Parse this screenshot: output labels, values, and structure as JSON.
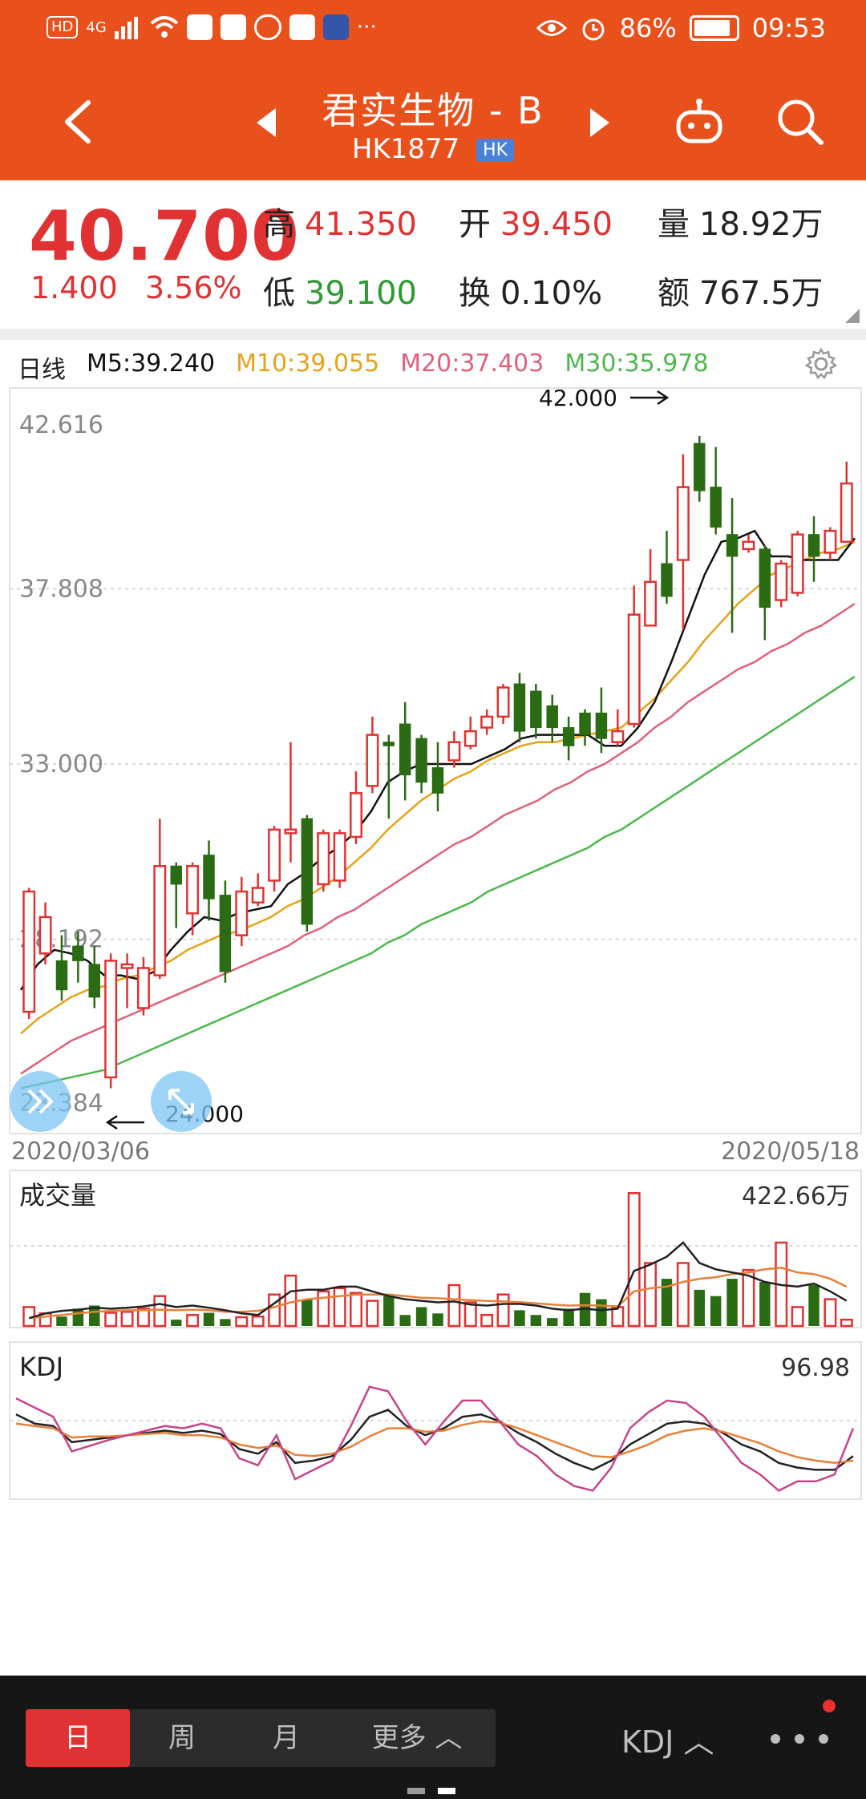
{
  "status_bar": {
    "hd": "HD",
    "network": "4G",
    "battery": "86%",
    "time": "09:53"
  },
  "header": {
    "title": "君实生物 - B",
    "code": "HK1877",
    "market_badge": "HK"
  },
  "quote": {
    "price": "40.700",
    "change": "1.400",
    "change_pct": "3.56%",
    "high_label": "高",
    "high": "41.350",
    "low_label": "低",
    "low": "39.100",
    "open_label": "开",
    "open": "39.450",
    "turnover_label": "换",
    "turnover": "0.10%",
    "volume_label": "量",
    "volume": "18.92万",
    "amount_label": "额",
    "amount": "767.5万"
  },
  "chart_header": {
    "period": "日线",
    "m5": "M5:39.240",
    "m10": "M10:39.055",
    "m20": "M20:37.403",
    "m30": "M30:35.978"
  },
  "colors": {
    "accent": "#e8501c",
    "up": "#e03232",
    "down": "#2a6b14",
    "ma5": "#111111",
    "ma10": "#e6a21a",
    "ma20": "#e0607a",
    "ma30": "#4cb84c",
    "kdj_j": "#c8438a",
    "vol_ma": "#e8803a"
  },
  "chart_data": [
    {
      "type": "candlestick",
      "title": "",
      "y_ticks": [
        "42.616",
        "37.808",
        "33.000",
        "28.192",
        "23.384"
      ],
      "ylim": [
        23.384,
        42.616
      ],
      "x_start": "2020/03/06",
      "x_end": "2020/05/18",
      "annotations": {
        "max": "42.000",
        "min": "24.000"
      },
      "candles": [
        [
          26.2,
          29.5,
          26.0,
          29.6
        ],
        [
          27.8,
          28.8,
          27.5,
          29.2
        ],
        [
          27.6,
          26.8,
          26.5,
          28.3
        ],
        [
          28.0,
          27.6,
          27.0,
          28.4
        ],
        [
          27.5,
          26.6,
          26.3,
          28.0
        ],
        [
          24.4,
          27.6,
          24.1,
          27.8
        ],
        [
          27.4,
          27.5,
          26.3,
          27.8
        ],
        [
          26.3,
          27.4,
          26.1,
          27.7
        ],
        [
          27.2,
          30.2,
          27.1,
          31.5
        ],
        [
          30.2,
          29.7,
          28.5,
          30.3
        ],
        [
          28.9,
          30.2,
          28.3,
          30.3
        ],
        [
          30.5,
          29.3,
          28.7,
          30.9
        ],
        [
          29.4,
          27.3,
          27.0,
          29.8
        ],
        [
          28.3,
          29.5,
          28.0,
          29.9
        ],
        [
          29.2,
          29.6,
          29.1,
          30.0
        ],
        [
          29.8,
          31.2,
          29.5,
          31.3
        ],
        [
          31.1,
          31.2,
          30.3,
          33.6
        ],
        [
          31.5,
          28.6,
          28.4,
          31.6
        ],
        [
          29.7,
          31.1,
          29.5,
          31.2
        ],
        [
          29.8,
          31.1,
          29.6,
          31.2
        ],
        [
          31.0,
          32.2,
          30.8,
          32.8
        ],
        [
          32.4,
          33.8,
          32.2,
          34.3
        ],
        [
          33.6,
          33.5,
          31.5,
          33.8
        ],
        [
          34.1,
          32.7,
          32.0,
          34.7
        ],
        [
          33.7,
          32.5,
          32.2,
          33.8
        ],
        [
          32.9,
          32.2,
          31.7,
          33.6
        ],
        [
          33.1,
          33.6,
          32.9,
          33.9
        ],
        [
          33.5,
          33.9,
          33.4,
          34.3
        ],
        [
          34.0,
          34.3,
          33.8,
          34.5
        ],
        [
          34.3,
          35.1,
          34.1,
          35.2
        ],
        [
          35.2,
          33.9,
          33.6,
          35.5
        ],
        [
          35.0,
          34.0,
          33.7,
          35.2
        ],
        [
          34.6,
          34.0,
          33.6,
          34.9
        ],
        [
          34.0,
          33.5,
          33.1,
          34.3
        ],
        [
          34.4,
          33.8,
          33.5,
          34.5
        ],
        [
          34.4,
          33.7,
          33.3,
          35.1
        ],
        [
          33.6,
          33.9,
          33.5,
          34.5
        ],
        [
          34.1,
          37.1,
          34.0,
          37.9
        ],
        [
          36.8,
          38.0,
          36.8,
          38.9
        ],
        [
          38.5,
          37.6,
          37.4,
          39.4
        ],
        [
          38.6,
          40.6,
          36.7,
          41.5
        ],
        [
          41.8,
          40.5,
          40.2,
          42.0
        ],
        [
          40.6,
          39.5,
          39.3,
          41.7
        ],
        [
          39.3,
          38.7,
          36.6,
          40.3
        ],
        [
          38.9,
          39.1,
          38.8,
          39.3
        ],
        [
          38.9,
          37.3,
          36.4,
          39.0
        ],
        [
          37.5,
          38.5,
          37.3,
          38.6
        ],
        [
          37.7,
          39.3,
          37.6,
          39.4
        ],
        [
          39.3,
          38.7,
          38.0,
          39.8
        ],
        [
          38.8,
          39.4,
          38.6,
          39.5
        ],
        [
          39.1,
          40.7,
          39.1,
          41.3
        ]
      ],
      "ma5": [
        26.8,
        27.5,
        27.9,
        27.8,
        27.6,
        27.2,
        27.2,
        27.1,
        27.3,
        27.9,
        28.4,
        28.8,
        28.7,
        28.9,
        29.0,
        29.1,
        29.7,
        30.0,
        30.4,
        30.7,
        31.1,
        31.7,
        32.5,
        32.8,
        33.0,
        33.0,
        33.0,
        33.0,
        33.2,
        33.4,
        33.7,
        33.8,
        33.8,
        33.8,
        33.8,
        33.5,
        33.5,
        34.0,
        34.7,
        35.8,
        37.0,
        38.2,
        39.1,
        39.2,
        39.4,
        38.7,
        38.7,
        38.6,
        38.6,
        38.6,
        39.2
      ],
      "ma10": [
        25.6,
        26.0,
        26.3,
        26.6,
        26.8,
        26.9,
        27.1,
        27.2,
        27.4,
        27.6,
        27.9,
        28.1,
        28.3,
        28.4,
        28.6,
        28.8,
        29.1,
        29.3,
        29.6,
        29.9,
        30.3,
        30.7,
        31.2,
        31.6,
        32.0,
        32.3,
        32.6,
        32.8,
        33.1,
        33.3,
        33.5,
        33.6,
        33.6,
        33.7,
        33.8,
        33.9,
        34.0,
        34.4,
        34.8,
        35.3,
        35.8,
        36.4,
        36.9,
        37.4,
        37.8,
        38.2,
        38.4,
        38.6,
        38.8,
        38.9,
        39.1
      ],
      "ma20": [
        24.5,
        24.8,
        25.1,
        25.4,
        25.6,
        25.8,
        26.0,
        26.2,
        26.4,
        26.6,
        26.8,
        27.0,
        27.2,
        27.4,
        27.6,
        27.8,
        28.0,
        28.3,
        28.5,
        28.8,
        29.0,
        29.3,
        29.6,
        29.9,
        30.2,
        30.5,
        30.8,
        31.0,
        31.3,
        31.6,
        31.8,
        32.0,
        32.3,
        32.5,
        32.8,
        33.0,
        33.3,
        33.6,
        34.0,
        34.3,
        34.7,
        35.0,
        35.3,
        35.6,
        35.8,
        36.1,
        36.3,
        36.6,
        36.8,
        37.1,
        37.4
      ],
      "ma30": [
        24.1,
        24.2,
        24.3,
        24.4,
        24.5,
        24.6,
        24.8,
        25.0,
        25.2,
        25.4,
        25.6,
        25.8,
        26.0,
        26.2,
        26.4,
        26.6,
        26.8,
        27.0,
        27.2,
        27.4,
        27.6,
        27.8,
        28.1,
        28.3,
        28.6,
        28.8,
        29.0,
        29.2,
        29.5,
        29.7,
        29.9,
        30.1,
        30.3,
        30.5,
        30.7,
        31.0,
        31.2,
        31.5,
        31.8,
        32.1,
        32.4,
        32.7,
        33.0,
        33.3,
        33.6,
        33.9,
        34.2,
        34.5,
        34.8,
        35.1,
        35.4
      ]
    },
    {
      "type": "bar",
      "title": "成交量",
      "max_label": "422.66万",
      "ylim": [
        0,
        422.66
      ],
      "values": [
        60,
        40,
        30,
        55,
        65,
        42,
        45,
        55,
        95,
        20,
        35,
        42,
        22,
        28,
        30,
        100,
        160,
        85,
        110,
        120,
        105,
        80,
        95,
        35,
        60,
        40,
        130,
        75,
        35,
        100,
        50,
        35,
        25,
        55,
        105,
        85,
        60,
        422,
        200,
        150,
        200,
        115,
        95,
        150,
        178,
        140,
        265,
        60,
        130,
        85,
        20
      ],
      "ma": [
        25,
        40,
        48,
        52,
        58,
        55,
        58,
        62,
        70,
        60,
        65,
        58,
        50,
        40,
        35,
        72,
        110,
        115,
        115,
        125,
        125,
        110,
        95,
        85,
        80,
        75,
        78,
        68,
        65,
        70,
        70,
        65,
        55,
        50,
        55,
        50,
        55,
        175,
        195,
        220,
        265,
        200,
        180,
        170,
        160,
        140,
        130,
        125,
        135,
        110,
        80
      ],
      "ma2": [
        25,
        30,
        35,
        40,
        45,
        48,
        50,
        50,
        52,
        50,
        52,
        50,
        45,
        45,
        48,
        60,
        75,
        85,
        90,
        95,
        100,
        100,
        100,
        95,
        90,
        88,
        85,
        82,
        80,
        78,
        76,
        72,
        68,
        65,
        66,
        65,
        62,
        110,
        120,
        125,
        140,
        150,
        155,
        165,
        170,
        180,
        185,
        170,
        165,
        150,
        125
      ]
    },
    {
      "type": "line",
      "title": "KDJ",
      "max_label": "96.98",
      "ylim": [
        0,
        100
      ],
      "series": [
        {
          "values": [
            72,
            64,
            62,
            48,
            50,
            52,
            54,
            56,
            58,
            56,
            58,
            55,
            42,
            38,
            48,
            30,
            32,
            36,
            50,
            70,
            76,
            62,
            54,
            60,
            70,
            72,
            66,
            56,
            48,
            38,
            30,
            24,
            32,
            46,
            55,
            64,
            66,
            64,
            56,
            46,
            40,
            30,
            26,
            24,
            24,
            36
          ]
        },
        {
          "values": [
            64,
            62,
            60,
            52,
            53,
            53,
            54,
            55,
            56,
            54,
            54,
            52,
            46,
            43,
            45,
            37,
            36,
            38,
            44,
            53,
            60,
            60,
            57,
            58,
            63,
            66,
            65,
            60,
            54,
            48,
            42,
            36,
            35,
            40,
            46,
            54,
            58,
            60,
            57,
            52,
            47,
            40,
            35,
            32,
            30,
            32
          ]
        },
        {
          "values": [
            86,
            78,
            70,
            40,
            45,
            50,
            54,
            58,
            62,
            60,
            64,
            60,
            34,
            28,
            54,
            16,
            24,
            32,
            62,
            96,
            92,
            66,
            46,
            66,
            84,
            84,
            66,
            46,
            36,
            20,
            10,
            6,
            26,
            60,
            74,
            84,
            82,
            70,
            50,
            30,
            20,
            6,
            14,
            14,
            20,
            60
          ]
        }
      ]
    }
  ],
  "bottom_bar": {
    "tabs": [
      "日",
      "周",
      "月",
      "更多 ︿"
    ],
    "indicator": "KDJ ︿"
  }
}
